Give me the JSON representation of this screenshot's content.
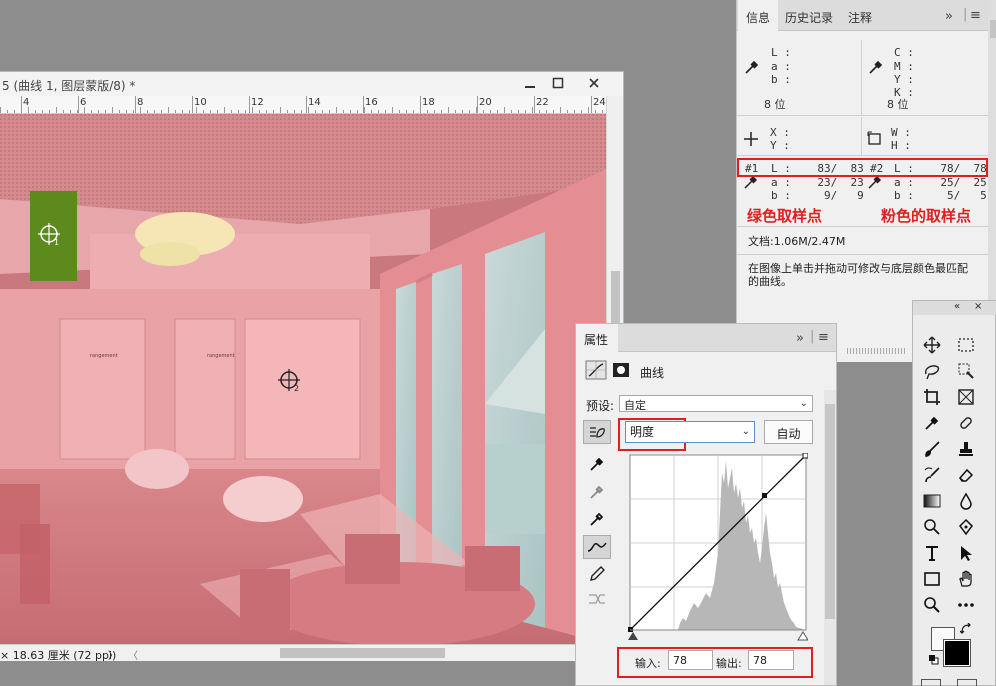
{
  "document": {
    "title": "5 (曲线 1, 图层蒙版/8) *",
    "ruler_numbers": [
      "4",
      "6",
      "8",
      "10",
      "12",
      "14",
      "16",
      "18",
      "20",
      "22",
      "24"
    ],
    "status_text": "× 18.63 厘米 (72 ppi)",
    "status_arrow": "〉",
    "scroll_left_arrow": "〈",
    "image": {
      "sampler1_label": "1",
      "sampler2_label": "2",
      "sign_text": "rangement"
    }
  },
  "info_panel": {
    "tabs": [
      "信息",
      "历史记录",
      "注释"
    ],
    "color1": {
      "L": "L :",
      "a": "a :",
      "b": "b :",
      "bits": "8 位"
    },
    "color2": {
      "C": "C :",
      "M": "M :",
      "Y": "Y :",
      "K": "K :",
      "bits": "8 位"
    },
    "position": {
      "X": "X :",
      "Y": "Y :"
    },
    "size": {
      "W": "W :",
      "H": "H :"
    },
    "sample1": {
      "id": "#1",
      "L": "L :    83/  83",
      "a": "a :    23/  23",
      "b": "b :     9/   9"
    },
    "sample2": {
      "id": "#2",
      "L": "L :    78/  78",
      "a": "a :    25/  25",
      "b": "b :     5/   5"
    },
    "annotation_green": "绿色取样点",
    "annotation_pink": "粉色的取样点",
    "doc_size": "文档:1.06M/2.47M",
    "hint": "在图像上单击并拖动可修改与底层颜色最匹配的曲线。",
    "accent_red": "#e02020"
  },
  "properties_panel": {
    "title": "属性",
    "layer_type": "曲线",
    "preset_label": "预设:",
    "preset_value": "自定",
    "channel_value": "明度",
    "auto_button": "自动",
    "input_label": "输入:",
    "input_value": "78",
    "output_label": "输出:",
    "output_value": "78"
  },
  "toolbox": {
    "tools": [
      "move-tool",
      "marquee-tool",
      "lasso-tool",
      "quick-select-tool",
      "crop-tool",
      "frame-tool",
      "eyedropper-tool",
      "healing-tool",
      "brush-tool",
      "stamp-tool",
      "history-brush-tool",
      "eraser-tool",
      "gradient-tool",
      "blur-tool",
      "dodge-tool",
      "pen-tool",
      "type-tool",
      "path-select-tool",
      "rectangle-tool",
      "hand-tool",
      "zoom-tool",
      "more-tool"
    ]
  }
}
